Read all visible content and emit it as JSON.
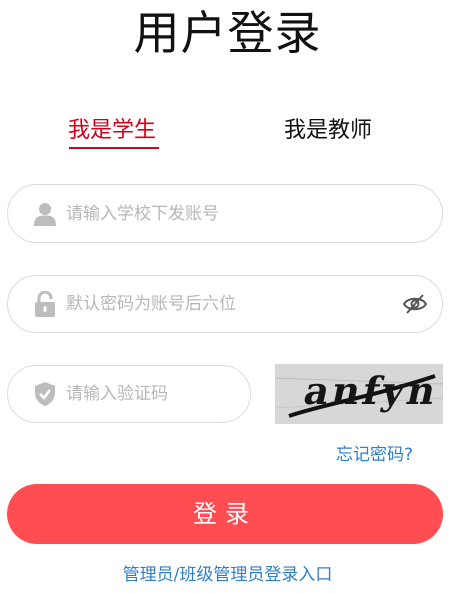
{
  "title": "用户登录",
  "tabs": [
    {
      "label": "我是学生",
      "active": true
    },
    {
      "label": "我是教师",
      "active": false
    }
  ],
  "fields": {
    "account": {
      "placeholder": "请输入学校下发账号",
      "icon": "user-icon"
    },
    "password": {
      "placeholder": "默认密码为账号后六位",
      "icon": "lock-icon",
      "toggle_icon": "eye-off-icon"
    },
    "captcha": {
      "placeholder": "请输入验证码",
      "icon": "shield-check-icon",
      "image_text": "anfyn"
    }
  },
  "forgot_password": "忘记密码?",
  "login_button": "登录",
  "admin_link": "管理员/班级管理员登录入口",
  "colors": {
    "accent_red": "#d0021b",
    "button_red": "#ff4d51",
    "link_blue": "#2f7fc8",
    "icon_gray": "#bdbdbd"
  }
}
